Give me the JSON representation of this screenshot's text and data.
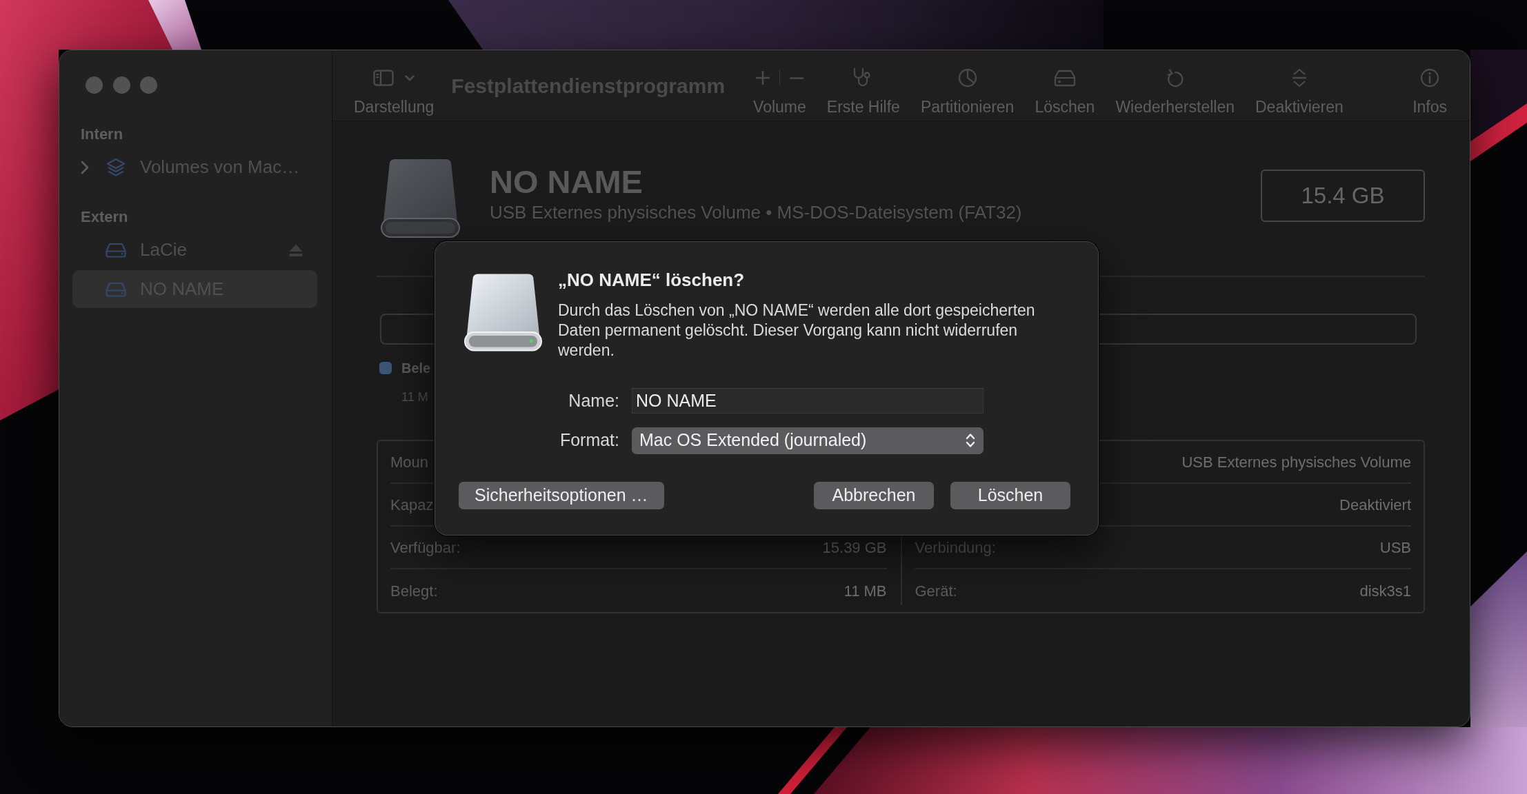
{
  "window": {
    "title": "Festplattendienstprogramm"
  },
  "toolbar": {
    "view_button": {
      "label": "Darstellung"
    },
    "actions": [
      {
        "kind": "volume",
        "label": "Volume"
      },
      {
        "kind": "first_aid",
        "label": "Erste Hilfe"
      },
      {
        "kind": "partition",
        "label": "Partitionieren"
      },
      {
        "kind": "erase",
        "label": "Löschen"
      },
      {
        "kind": "restore",
        "label": "Wiederherstellen"
      },
      {
        "kind": "unmount",
        "label": "Deaktivieren"
      },
      {
        "kind": "info",
        "label": "Infos"
      }
    ]
  },
  "sidebar": {
    "sections": [
      {
        "title": "Intern",
        "items": [
          {
            "kind": "volume_group",
            "label": "Volumes von Mac…",
            "expanded": false,
            "selected": false
          }
        ]
      },
      {
        "title": "Extern",
        "items": [
          {
            "kind": "disk",
            "label": "LaCie",
            "eject": true,
            "selected": false
          },
          {
            "kind": "disk",
            "label": "NO NAME",
            "eject": false,
            "selected": true
          }
        ]
      }
    ]
  },
  "volume": {
    "name": "NO NAME",
    "description": "USB Externes physisches Volume • MS-DOS-Dateisystem (FAT32)",
    "capacity": "15.4 GB",
    "legend": [
      {
        "label": "Bele",
        "value": "11 M",
        "color": "#3b5675"
      }
    ],
    "details": {
      "left": [
        {
          "label": "Moun"
        },
        {
          "label": "Kapaz"
        },
        {
          "label": "Verfügbar:",
          "value": "15.39 GB"
        },
        {
          "label": "Belegt:",
          "value": "11 MB"
        }
      ],
      "right": [
        {
          "value": "USB Externes physisches Volume"
        },
        {
          "value": "Deaktiviert"
        },
        {
          "label": "Verbindung:",
          "value": "USB"
        },
        {
          "label": "Gerät:",
          "value": "disk3s1"
        }
      ]
    }
  },
  "dialog": {
    "title": "„NO NAME“ löschen?",
    "message": "Durch das Löschen von „NO NAME“ werden alle dort gespeicherten Daten permanent gelöscht. Dieser Vorgang kann nicht widerrufen werden.",
    "fields": [
      {
        "kind": "text",
        "label": "Name:",
        "value": "NO NAME"
      },
      {
        "kind": "popup",
        "label": "Format:",
        "value": "Mac OS Extended (journaled)"
      }
    ],
    "buttons": [
      {
        "kind": "options",
        "label": "Sicherheitsoptionen …"
      },
      {
        "kind": "cancel",
        "label": "Abbrechen"
      },
      {
        "kind": "confirm",
        "label": "Löschen"
      }
    ]
  }
}
